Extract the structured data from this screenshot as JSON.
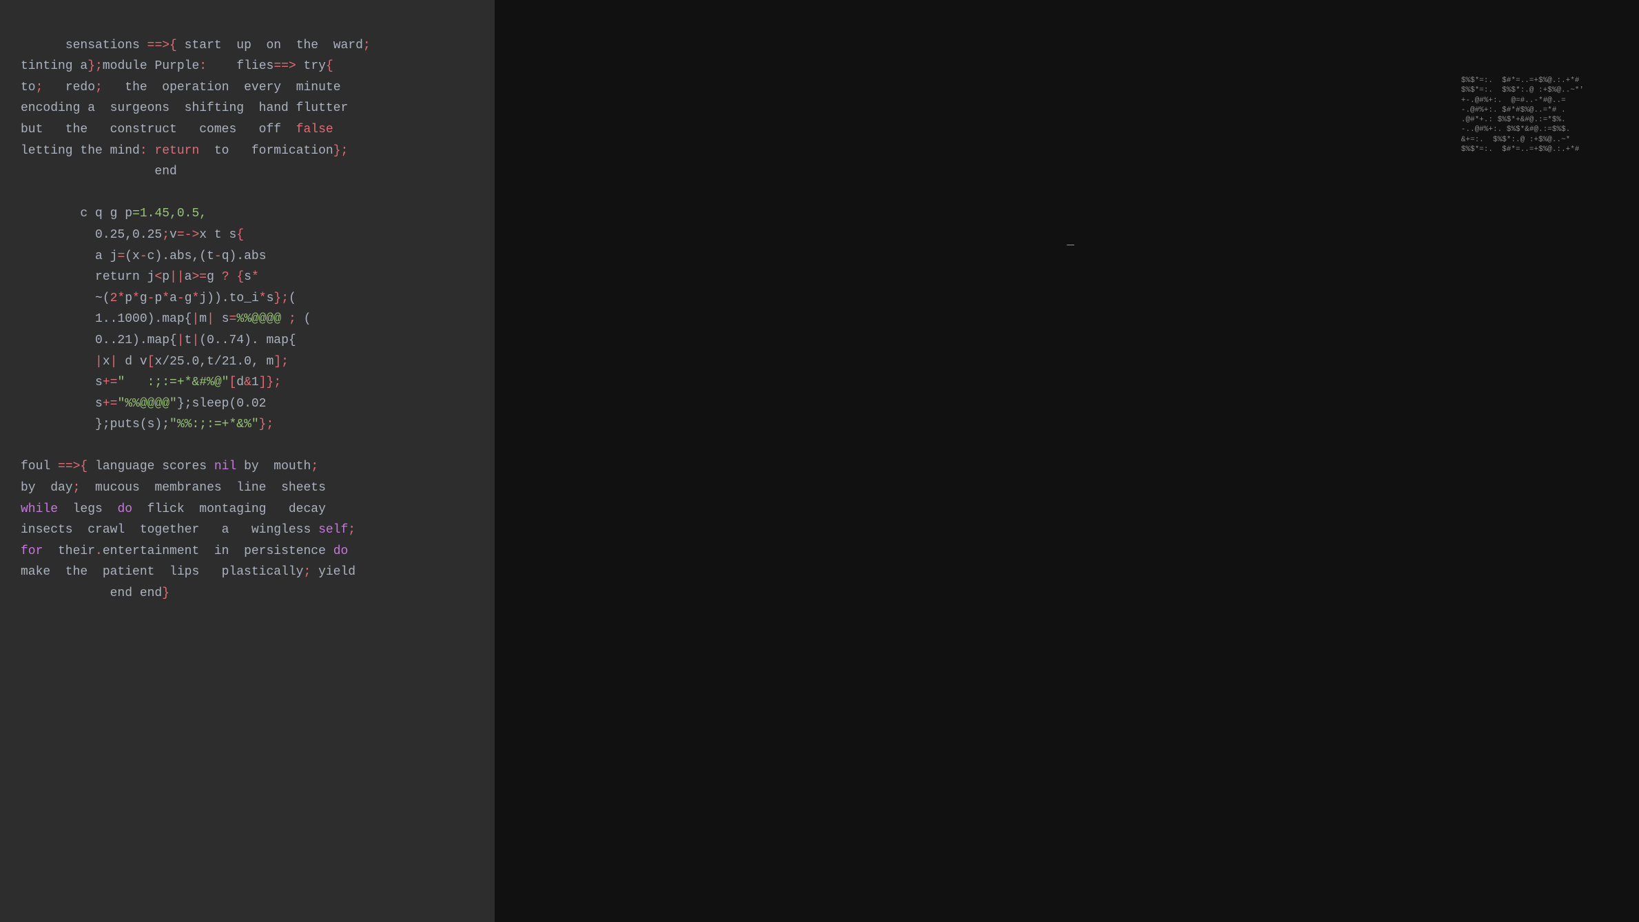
{
  "left": {
    "code_block_1": {
      "lines": [
        {
          "text": "sensations ",
          "parts": [
            {
              "t": "sensations ",
              "c": "normal"
            },
            {
              "t": "==>",
              "c": "red"
            },
            {
              "t": "{",
              "c": "red"
            },
            {
              "t": " start  up  on  the  ward",
              "c": "normal"
            },
            {
              "t": ";",
              "c": "red"
            }
          ]
        },
        {
          "text": "tinting a",
          "parts": [
            {
              "t": "tinting a",
              "c": "normal"
            },
            {
              "t": "}",
              "c": "red"
            },
            {
              "t": ";",
              "c": "red"
            },
            {
              "t": "module Purple",
              "c": "normal"
            },
            {
              "t": ":",
              "c": "red"
            },
            {
              "t": "   flies",
              "c": "normal"
            },
            {
              "t": "==>",
              "c": "red"
            },
            {
              "t": " try",
              "c": "normal"
            },
            {
              "t": "{",
              "c": "red"
            }
          ]
        },
        {
          "text": "to",
          "parts": [
            {
              "t": "to",
              "c": "normal"
            },
            {
              "t": ";",
              "c": "red"
            },
            {
              "t": "  redo",
              "c": "normal"
            },
            {
              "t": ";",
              "c": "red"
            },
            {
              "t": "  the  operation  every  minute",
              "c": "normal"
            }
          ]
        },
        {
          "text": "encoding a  surgeons  shifting  hand flutter",
          "parts": [
            {
              "t": "encoding a  surgeons  shifting  hand flutter",
              "c": "normal"
            }
          ]
        },
        {
          "text": "but   the   construct  comes   off",
          "parts": [
            {
              "t": "but   the   construct  comes   off  ",
              "c": "normal"
            },
            {
              "t": "false",
              "c": "red"
            }
          ]
        },
        {
          "text": "letting the mind",
          "parts": [
            {
              "t": "letting the mind",
              "c": "normal"
            },
            {
              "t": ":",
              "c": "red"
            },
            {
              "t": " ",
              "c": "normal"
            },
            {
              "t": "return",
              "c": "red"
            },
            {
              "t": " to   formication",
              "c": "normal"
            },
            {
              "t": "}",
              "c": "red"
            },
            {
              "t": ";",
              "c": "red"
            }
          ]
        },
        {
          "text": "                  end",
          "parts": [
            {
              "t": "                  end",
              "c": "normal"
            }
          ]
        }
      ]
    },
    "code_block_2": {
      "lines": [
        {
          "parts": [
            {
              "t": "        c",
              "c": "normal"
            },
            {
              "t": " ",
              "c": "normal"
            },
            {
              "t": "q",
              "c": "normal"
            },
            {
              "t": " g p",
              "c": "normal"
            },
            {
              "t": "=1.45,0.5,",
              "c": "string"
            }
          ]
        },
        {
          "parts": [
            {
              "t": "          0.25,0.25",
              "c": "string"
            },
            {
              "t": ";",
              "c": "red"
            },
            {
              "t": "v",
              "c": "normal"
            },
            {
              "t": "=->",
              "c": "red"
            },
            {
              "t": "x",
              "c": "normal"
            },
            {
              "t": " t",
              "c": "normal"
            },
            {
              "t": " s",
              "c": "normal"
            },
            {
              "t": "{",
              "c": "red"
            }
          ]
        },
        {
          "parts": [
            {
              "t": "          a",
              "c": "normal"
            },
            {
              "t": " j",
              "c": "normal"
            },
            {
              "t": "=",
              "c": "red"
            },
            {
              "t": "(x",
              "c": "normal"
            },
            {
              "t": "-",
              "c": "red"
            },
            {
              "t": "c)",
              "c": "normal"
            },
            {
              "t": ".abs,(t",
              "c": "normal"
            },
            {
              "t": "-",
              "c": "red"
            },
            {
              "t": "q).abs",
              "c": "normal"
            }
          ]
        },
        {
          "parts": [
            {
              "t": "          return j",
              "c": "normal"
            },
            {
              "t": "<",
              "c": "red"
            },
            {
              "t": "p",
              "c": "normal"
            },
            {
              "t": "||",
              "c": "red"
            },
            {
              "t": "a",
              "c": "normal"
            },
            {
              "t": ">=",
              "c": "red"
            },
            {
              "t": "g",
              "c": "normal"
            },
            {
              "t": " ",
              "c": "normal"
            },
            {
              "t": "?",
              "c": "red"
            },
            {
              "t": " ",
              "c": "normal"
            },
            {
              "t": "{",
              "c": "red"
            },
            {
              "t": "s",
              "c": "normal"
            },
            {
              "t": "*",
              "c": "red"
            }
          ]
        },
        {
          "parts": [
            {
              "t": "          ~(",
              "c": "normal"
            },
            {
              "t": "2*",
              "c": "red"
            },
            {
              "t": "p",
              "c": "normal"
            },
            {
              "t": "*",
              "c": "red"
            },
            {
              "t": "g",
              "c": "normal"
            },
            {
              "t": "-",
              "c": "red"
            },
            {
              "t": "p",
              "c": "normal"
            },
            {
              "t": "*",
              "c": "red"
            },
            {
              "t": "a",
              "c": "normal"
            },
            {
              "t": "-",
              "c": "red"
            },
            {
              "t": "g",
              "c": "normal"
            },
            {
              "t": "*",
              "c": "red"
            },
            {
              "t": "j)).to_i*s",
              "c": "normal"
            },
            {
              "t": "};",
              "c": "red"
            },
            {
              "t": "(",
              "c": "normal"
            }
          ]
        },
        {
          "parts": [
            {
              "t": "          1..1000).map{",
              "c": "normal"
            },
            {
              "t": "|",
              "c": "red"
            },
            {
              "t": "m",
              "c": "normal"
            },
            {
              "t": "|",
              "c": "red"
            },
            {
              "t": " ",
              "c": "normal"
            },
            {
              "t": "s",
              "c": "normal"
            },
            {
              "t": "=",
              "c": "red"
            },
            {
              "t": "%%@@",
              "c": "string"
            },
            {
              "t": " ",
              "c": "normal"
            },
            {
              "t": ";",
              "c": "red"
            },
            {
              "t": " (",
              "c": "normal"
            }
          ]
        },
        {
          "parts": [
            {
              "t": "          0..21).map{",
              "c": "normal"
            },
            {
              "t": "|",
              "c": "red"
            },
            {
              "t": "t",
              "c": "normal"
            },
            {
              "t": "|",
              "c": "red"
            },
            {
              "t": "(0..74). map{",
              "c": "normal"
            }
          ]
        },
        {
          "parts": [
            {
              "t": "          ",
              "c": "normal"
            },
            {
              "t": "|",
              "c": "red"
            },
            {
              "t": "x",
              "c": "normal"
            },
            {
              "t": "|",
              "c": "red"
            },
            {
              "t": " d",
              "c": "normal"
            },
            {
              "t": " ",
              "c": "normal"
            },
            {
              "t": "v",
              "c": "normal"
            },
            {
              "t": "[",
              "c": "red"
            },
            {
              "t": "x/25.0,t/21.0, m",
              "c": "normal"
            },
            {
              "t": "]",
              "c": "red"
            },
            {
              "t": ";",
              "c": "red"
            }
          ]
        },
        {
          "parts": [
            {
              "t": "          s",
              "c": "normal"
            },
            {
              "t": "+=",
              "c": "red"
            },
            {
              "t": "\"   :;:=+*&#%@\"",
              "c": "string"
            },
            {
              "t": "[",
              "c": "red"
            },
            {
              "t": "d",
              "c": "normal"
            },
            {
              "t": "&",
              "c": "red"
            },
            {
              "t": "1",
              "c": "normal"
            },
            {
              "t": "]",
              "c": "red"
            },
            {
              "t": "};",
              "c": "red"
            }
          ]
        },
        {
          "parts": [
            {
              "t": "          s",
              "c": "normal"
            },
            {
              "t": "+=",
              "c": "red"
            },
            {
              "t": "\"%%@@@@\"",
              "c": "string"
            },
            {
              "t": "};sleep(0.02",
              "c": "normal"
            }
          ]
        },
        {
          "parts": [
            {
              "t": "          };puts(s);",
              "c": "normal"
            },
            {
              "t": "\"%%:;:=+*&%\"",
              "c": "string"
            },
            {
              "t": "};",
              "c": "red"
            }
          ]
        }
      ]
    },
    "code_block_3": {
      "lines": [
        {
          "parts": [
            {
              "t": "foul ",
              "c": "normal"
            },
            {
              "t": "==>",
              "c": "red"
            },
            {
              "t": "{",
              "c": "red"
            },
            {
              "t": " language scores ",
              "c": "normal"
            },
            {
              "t": "nil",
              "c": "keyword"
            },
            {
              "t": " by  mouth",
              "c": "normal"
            },
            {
              "t": ";",
              "c": "red"
            }
          ]
        },
        {
          "parts": [
            {
              "t": "by  day",
              "c": "normal"
            },
            {
              "t": ";",
              "c": "red"
            },
            {
              "t": "  mucous  membranes  line  sheets",
              "c": "normal"
            }
          ]
        },
        {
          "parts": [
            {
              "t": "while",
              "c": "keyword"
            },
            {
              "t": "  legs  ",
              "c": "normal"
            },
            {
              "t": "do",
              "c": "keyword"
            },
            {
              "t": "  flick  montaging   decay",
              "c": "normal"
            }
          ]
        },
        {
          "parts": [
            {
              "t": "insects  crawl  together   a   wingless ",
              "c": "normal"
            },
            {
              "t": "self",
              "c": "keyword"
            },
            {
              "t": ";",
              "c": "red"
            }
          ]
        },
        {
          "parts": [
            {
              "t": "for",
              "c": "keyword"
            },
            {
              "t": "  their",
              "c": "normal"
            },
            {
              "t": ".",
              "c": "red"
            },
            {
              "t": "entertainment  in  persistence ",
              "c": "normal"
            },
            {
              "t": "do",
              "c": "keyword"
            }
          ]
        },
        {
          "parts": [
            {
              "t": "make  the  patient  lips   plastically",
              "c": "normal"
            },
            {
              "t": ";",
              "c": "red"
            },
            {
              "t": " yield",
              "c": "normal"
            }
          ]
        },
        {
          "parts": [
            {
              "t": "            end end",
              "c": "normal"
            },
            {
              "t": "}",
              "c": "red"
            }
          ]
        }
      ]
    }
  },
  "right": {
    "ascii_art": "$%$*=:.  $#*=..=+$%@.:.+*#\n$%$*=:.  $%$*:.@ :+$%@..~*'\n+-.@#%+:.  @=#..-*#@..=\n-.@#%+:. $#*#$%@..=*# .\n.@#*+.: $%$*+&#@.:=*$%.\n-..@#%+:. $%$*&#@.:=$%$.\n&+=:.  $%$*:.@ :+$%@..~*\n$%$*=:.  $#*=..=+$%@.:.+*#"
  }
}
